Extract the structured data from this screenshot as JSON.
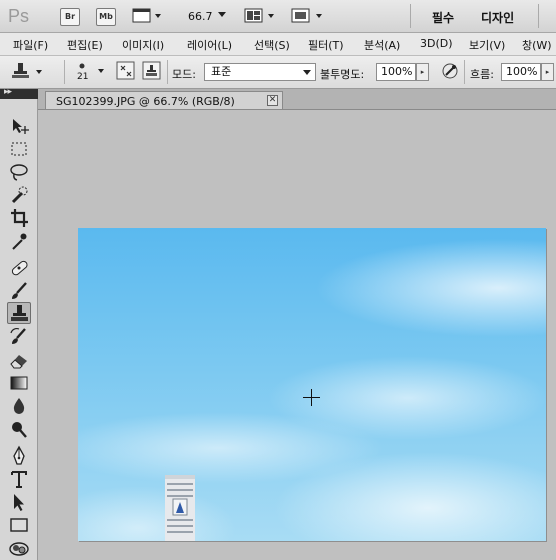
{
  "app": {
    "logo": "Ps",
    "bridge_label": "Br",
    "minibridge_label": "Mb",
    "zoom": "66.7",
    "workspaces": [
      "필수",
      "디자인"
    ]
  },
  "menu": [
    "파일(F)",
    "편집(E)",
    "이미지(I)",
    "레이어(L)",
    "선택(S)",
    "필터(T)",
    "분석(A)",
    "3D(D)",
    "보기(V)",
    "창(W)"
  ],
  "options": {
    "brush_size": "21",
    "mode_label": "모드:",
    "mode_value": "표준",
    "opacity_label": "불투명도:",
    "opacity_value": "100%",
    "flow_label": "흐름:",
    "flow_value": "100%"
  },
  "document": {
    "tab_title": "SG102399.JPG @ 66.7% (RGB/8)",
    "close_glyph": "✕"
  },
  "tools": [
    "move-tool",
    "marquee-tool",
    "lasso-tool",
    "quick-selection-tool",
    "crop-tool",
    "eyedropper-tool",
    "spot-healing-tool",
    "brush-tool",
    "clone-stamp-tool",
    "history-brush-tool",
    "eraser-tool",
    "gradient-tool",
    "blur-tool",
    "dodge-tool",
    "pen-tool",
    "type-tool",
    "path-selection-tool",
    "rectangle-tool",
    "3d-rotate-tool"
  ],
  "toolbox_header": "▸▸"
}
